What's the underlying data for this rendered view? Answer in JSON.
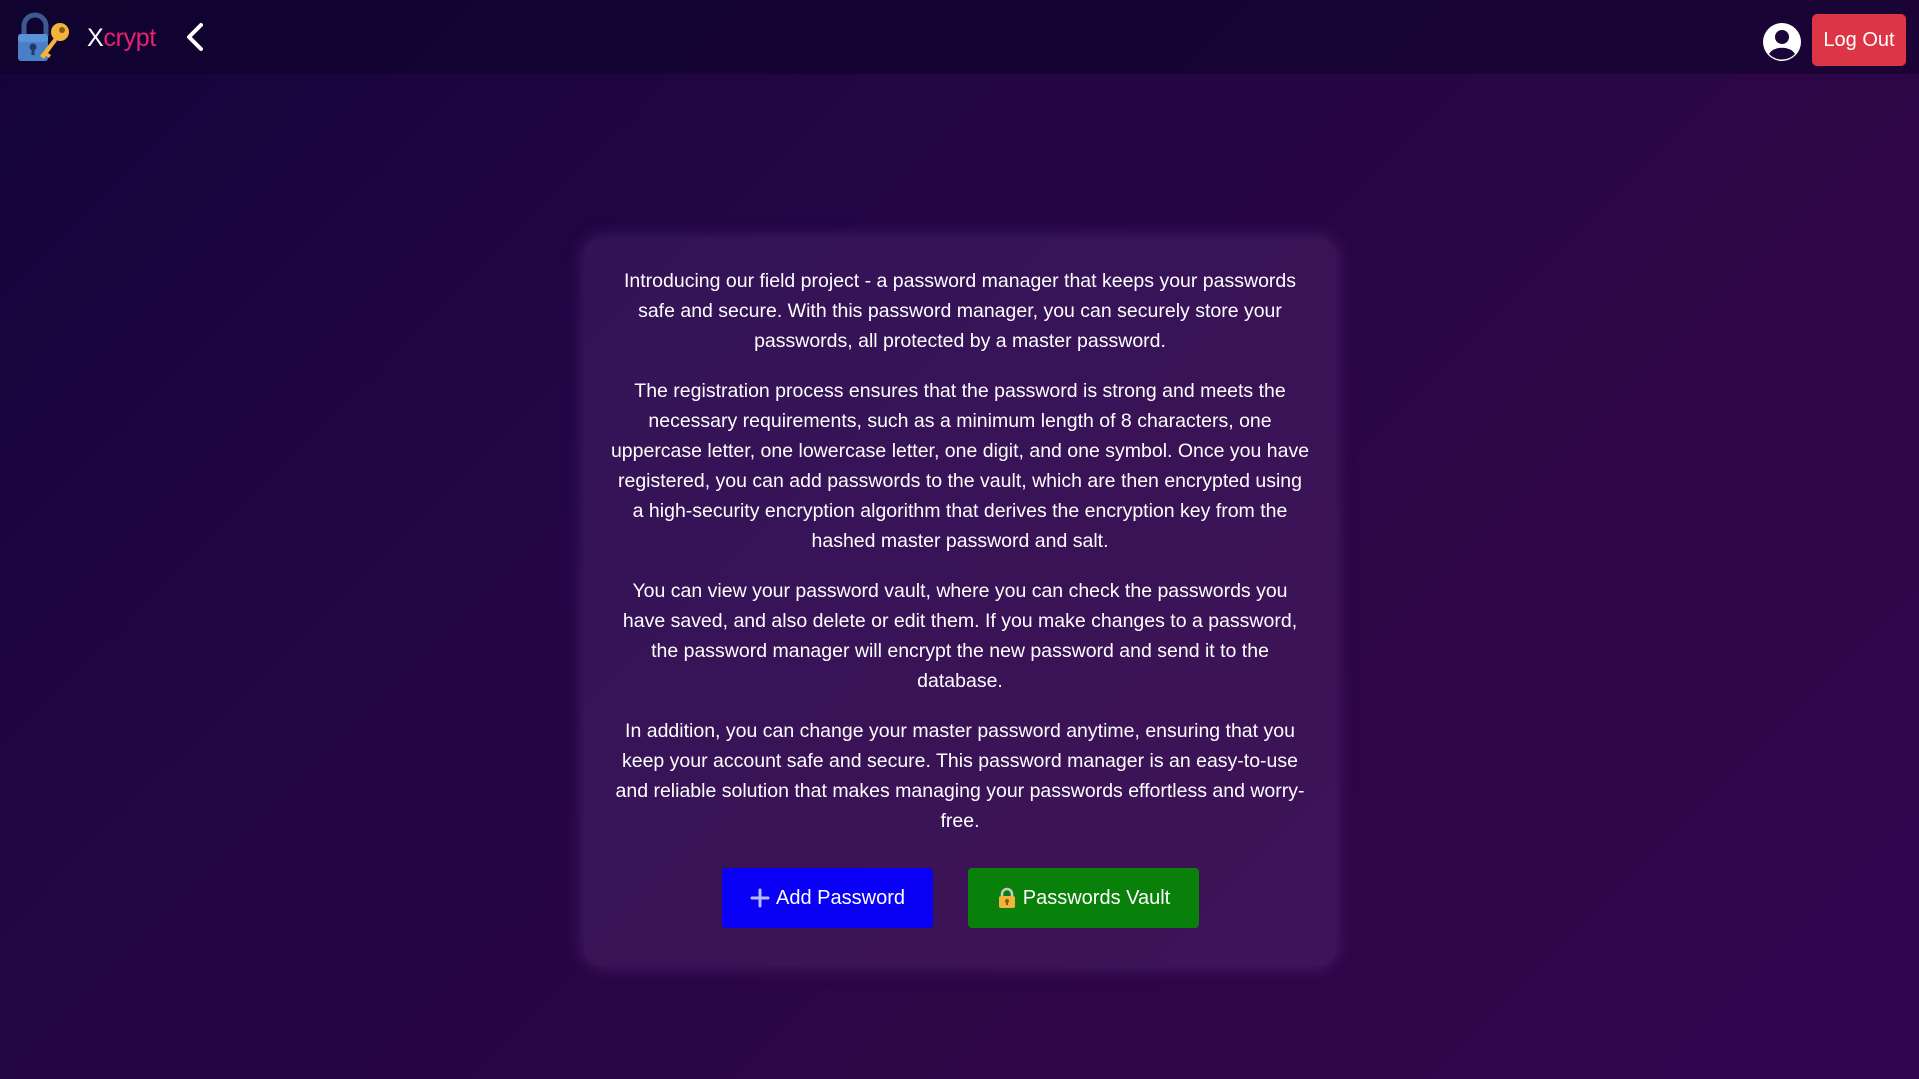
{
  "navbar": {
    "logo_icon": "lock-key-icon",
    "brand_first": "X",
    "brand_rest": "crypt",
    "brand_first_color": "#ffffff",
    "brand_rest_color": "#e8226e",
    "back_icon": "chevron-left-icon",
    "account_icon": "user-circle-icon",
    "logout_label": "Log Out",
    "logout_color": "#dc3545"
  },
  "main": {
    "paragraphs": [
      "Introducing our field project - a password manager that keeps your passwords safe and secure. With this password manager, you can securely store your passwords, all protected by a master password.",
      "The registration process ensures that the password is strong and meets the necessary requirements, such as a minimum length of 8 characters, one uppercase letter, one lowercase letter, one digit, and one symbol. Once you have registered, you can add passwords to the vault, which are then encrypted using a high-security encryption algorithm that derives the encryption key from the hashed master password and salt.",
      "You can view your password vault, where you can check the passwords you have saved, and also delete or edit them. If you make changes to a password, the password manager will encrypt the new password and send it to the database.",
      "In addition, you can change your master password anytime, ensuring that you keep your account safe and secure. This password manager is an easy-to-use and reliable solution that makes managing your passwords effortless and worry-free."
    ],
    "add_button": {
      "label": "Add Password",
      "icon": "plus-icon",
      "color": "#0a00f5"
    },
    "vault_button": {
      "label": "Passwords Vault",
      "icon": "lock-icon",
      "color": "#098009"
    }
  }
}
